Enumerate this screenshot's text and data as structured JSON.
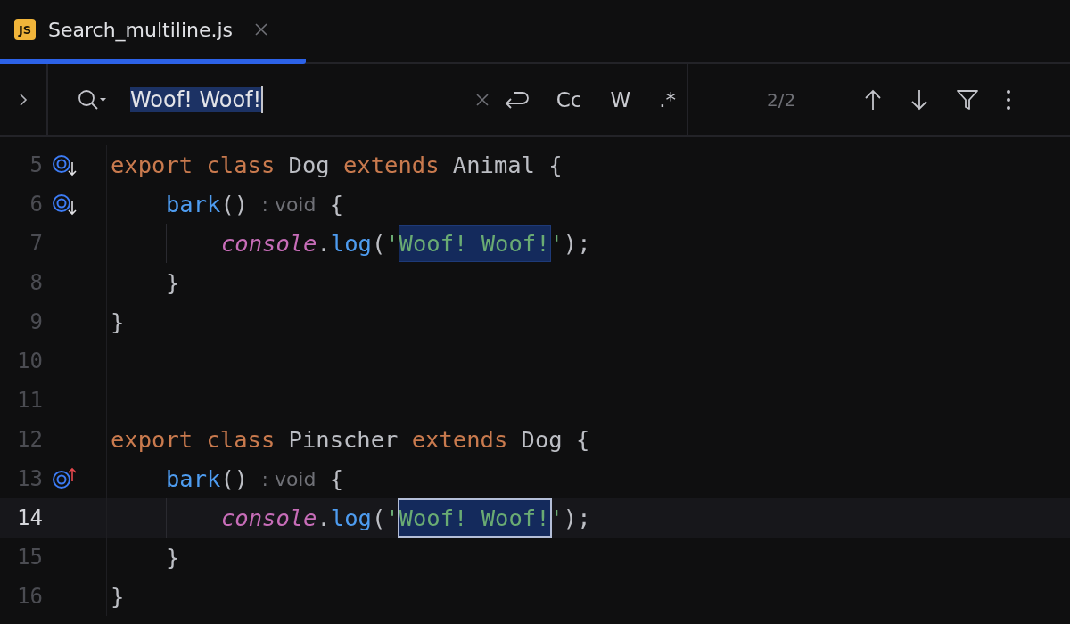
{
  "tab": {
    "icon_label": "JS",
    "title": "Search_multiline.js",
    "selected": true
  },
  "search": {
    "value": "Woof! Woof!",
    "value_selected": true,
    "toggles": [
      "Cc",
      "W",
      ".*"
    ],
    "match_count": "2/2"
  },
  "lines": [
    {
      "number": "5",
      "current": false,
      "kind": "top",
      "gutter_icon": {
        "kind": "implemented"
      },
      "indent_guide": false,
      "tokens": [
        {
          "kind": "keyword",
          "text": "export class "
        },
        {
          "kind": "plain",
          "text": "Dog "
        },
        {
          "kind": "keyword",
          "text": "extends "
        },
        {
          "kind": "plain",
          "text": "Animal {"
        }
      ]
    },
    {
      "number": "6",
      "current": false,
      "kind": "member",
      "gutter_icon": {
        "kind": "implemented"
      },
      "indent_guide": false,
      "tokens": [
        {
          "kind": "func",
          "text": "bark"
        },
        {
          "kind": "plain",
          "text": "() "
        },
        {
          "kind": "hint",
          "text": ": void"
        },
        {
          "kind": "plain",
          "text": " {"
        }
      ]
    },
    {
      "number": "7",
      "current": false,
      "kind": "body",
      "indent_guide": true,
      "tokens": [
        {
          "kind": "object",
          "text": "console"
        },
        {
          "kind": "plain",
          "text": "."
        },
        {
          "kind": "func",
          "text": "log"
        },
        {
          "kind": "plain",
          "text": "("
        },
        {
          "kind": "string",
          "text": "'"
        },
        {
          "kind": "match",
          "text": "Woof! Woof!",
          "selected": false
        },
        {
          "kind": "string",
          "text": "'"
        },
        {
          "kind": "plain",
          "text": ");"
        }
      ]
    },
    {
      "number": "8",
      "current": false,
      "kind": "member",
      "indent_guide": false,
      "tokens": [
        {
          "kind": "plain",
          "text": "}"
        }
      ]
    },
    {
      "number": "9",
      "current": false,
      "kind": "top",
      "indent_guide": false,
      "tokens": [
        {
          "kind": "plain",
          "text": "}"
        }
      ]
    },
    {
      "number": "10",
      "current": false,
      "kind": "top",
      "indent_guide": false
    },
    {
      "number": "11",
      "current": false,
      "kind": "top",
      "indent_guide": false
    },
    {
      "number": "12",
      "current": false,
      "kind": "top",
      "indent_guide": false,
      "tokens": [
        {
          "kind": "keyword",
          "text": "export class "
        },
        {
          "kind": "plain",
          "text": "Pinscher "
        },
        {
          "kind": "keyword",
          "text": "extends "
        },
        {
          "kind": "plain",
          "text": "Dog {"
        }
      ]
    },
    {
      "number": "13",
      "current": false,
      "kind": "member",
      "gutter_icon": {
        "kind": "overrides"
      },
      "indent_guide": false,
      "tokens": [
        {
          "kind": "func",
          "text": "bark"
        },
        {
          "kind": "plain",
          "text": "() "
        },
        {
          "kind": "hint",
          "text": ": void"
        },
        {
          "kind": "plain",
          "text": " {"
        }
      ]
    },
    {
      "number": "14",
      "current": true,
      "kind": "body",
      "indent_guide": true,
      "tokens": [
        {
          "kind": "object",
          "text": "console"
        },
        {
          "kind": "plain",
          "text": "."
        },
        {
          "kind": "func",
          "text": "log"
        },
        {
          "kind": "plain",
          "text": "("
        },
        {
          "kind": "string",
          "text": "'"
        },
        {
          "kind": "match",
          "text": "Woof! Woof!",
          "selected": true
        },
        {
          "kind": "string",
          "text": "'"
        },
        {
          "kind": "plain",
          "text": ");"
        }
      ]
    },
    {
      "number": "15",
      "current": false,
      "kind": "member",
      "indent_guide": false,
      "tokens": [
        {
          "kind": "plain",
          "text": "}"
        }
      ]
    },
    {
      "number": "16",
      "current": false,
      "kind": "top",
      "indent_guide": false,
      "tokens": [
        {
          "kind": "plain",
          "text": "}"
        }
      ]
    }
  ]
}
